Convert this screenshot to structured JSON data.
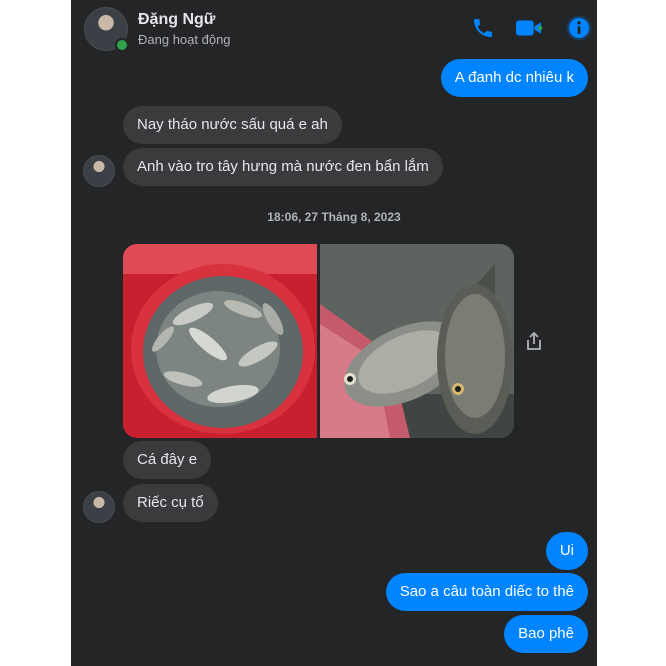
{
  "header": {
    "name": "Đặng Ngữ",
    "status": "Đang hoạt động"
  },
  "messages": [
    {
      "side": "out",
      "text": "A đanh dc nhiêu k"
    },
    {
      "side": "in",
      "text": "Nay tháo nước sấu quá e ah"
    },
    {
      "side": "in",
      "text": "Anh vào tro tây hưng mà nước đen bẩn lắm"
    },
    {
      "side": "in",
      "text": "Cá đây e"
    },
    {
      "side": "in",
      "text": "Riếc cụ tổ"
    },
    {
      "side": "out",
      "text": "Ui"
    },
    {
      "side": "out",
      "text": "Sao a câu toàn diếc to thê"
    },
    {
      "side": "out",
      "text": "Bao phê"
    }
  ],
  "timestamp": "18:06, 27 Tháng 8, 2023",
  "icons": {
    "call": "phone-icon",
    "video": "video-camera-icon",
    "info": "info-icon",
    "share": "share-icon"
  },
  "colors": {
    "background": "#242526",
    "incoming_bubble": "#3a3b3c",
    "outgoing_bubble": "#0084ff",
    "accent": "#0084ff",
    "online": "#31a24c"
  }
}
